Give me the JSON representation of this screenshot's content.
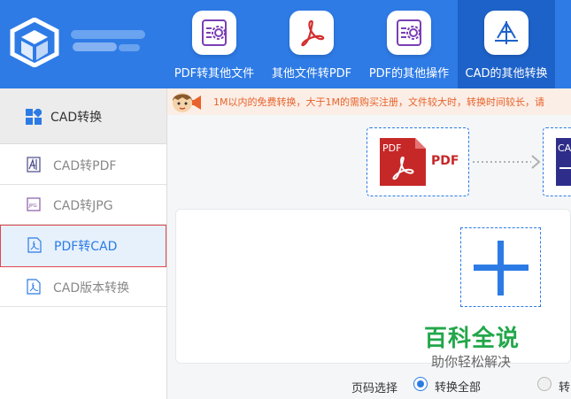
{
  "toolbar": {
    "tools": [
      {
        "label": "PDF转其他文件",
        "icon": "pdf-gear-icon"
      },
      {
        "label": "其他文件转PDF",
        "icon": "acrobat-icon"
      },
      {
        "label": "PDF的其他操作",
        "icon": "pdf-settings-icon"
      },
      {
        "label": "CAD的其他转换",
        "icon": "cad-drafting-icon",
        "active": true
      }
    ]
  },
  "sidebar": {
    "header": "CAD转换",
    "items": [
      {
        "label": "CAD转PDF",
        "icon": "cad-file-icon"
      },
      {
        "label": "CAD转JPG",
        "icon": "jpg-file-icon"
      },
      {
        "label": "PDF转CAD",
        "icon": "pdf-file-icon",
        "selected": true
      },
      {
        "label": "CAD版本转换",
        "icon": "pdf-file-icon"
      }
    ]
  },
  "notice": {
    "text": "1M以内的免费转换，大于1M的需购买注册，文件较大时，转换时间较长，请"
  },
  "conversion": {
    "source_badge": "PDF",
    "source_label": "PDF",
    "target_badge": "CA"
  },
  "watermark": {
    "title": "百科全说",
    "subtitle": "助你轻松解决"
  },
  "page_select": {
    "label": "页码选择",
    "option_all": "转换全部",
    "option_partial": "转"
  },
  "colors": {
    "primary": "#2e7be6",
    "active_tab": "#1d62c8",
    "selected_border": "#e0484f",
    "notice_text": "#e8622b",
    "pdf_red": "#c62828",
    "watermark_green": "#22a74a"
  }
}
